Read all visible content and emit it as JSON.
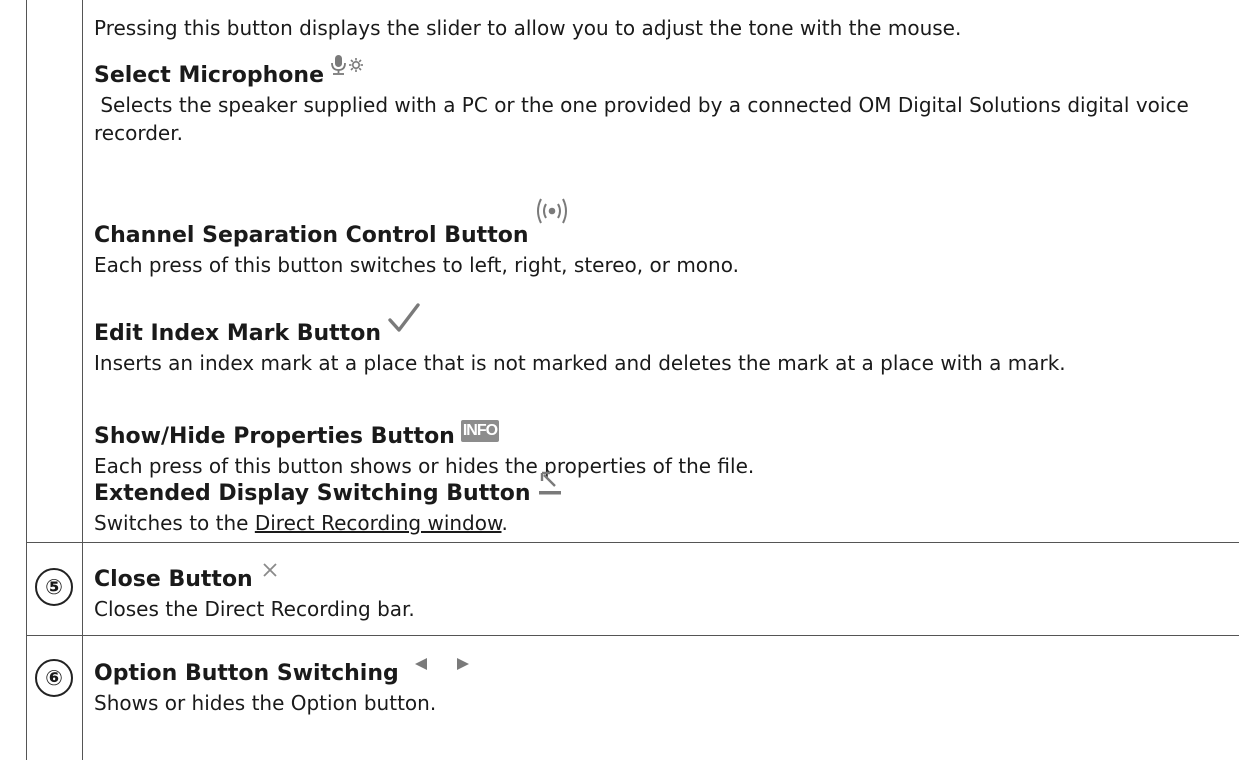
{
  "intro": {
    "text": "Pressing this button displays the slider to allow you to adjust the tone with the mouse."
  },
  "items": [
    {
      "title": "Select Microphone",
      "icon": "microphone-settings-icon",
      "description": " Selects the speaker supplied with a PC or the one provided by a connected OM Digital Solutions digital voice recorder."
    },
    {
      "title": "Channel Separation Control Button",
      "icon": "channel-separation-icon",
      "description": "Each press of this button switches to left, right, stereo, or mono."
    },
    {
      "title": "Edit Index Mark Button",
      "icon": "checkmark-icon",
      "description": "Inserts an index mark at a place that is not marked and deletes the mark at a place with a mark."
    },
    {
      "title": "Show/Hide Properties Button",
      "icon": "info-icon",
      "icon_text": "INFO",
      "description": "Each press of this button shows or hides the properties of the file."
    },
    {
      "title": "Extended Display Switching Button",
      "icon": "extended-display-icon",
      "description_prefix": "Switches to the ",
      "description_link": "Direct Recording window",
      "description_suffix": "."
    }
  ],
  "rows": [
    {
      "number": "⑤",
      "title": "Close Button",
      "icon": "close-icon",
      "description": "Closes the Direct Recording bar."
    },
    {
      "number": "⑥",
      "title": "Option Button Switching",
      "icon": "left-right-arrows-icon",
      "description": "Shows or hides the Option button."
    }
  ],
  "colors": {
    "border": "#555555",
    "icon_gray": "#7a7a7a",
    "info_bg": "#8c8c8c"
  }
}
